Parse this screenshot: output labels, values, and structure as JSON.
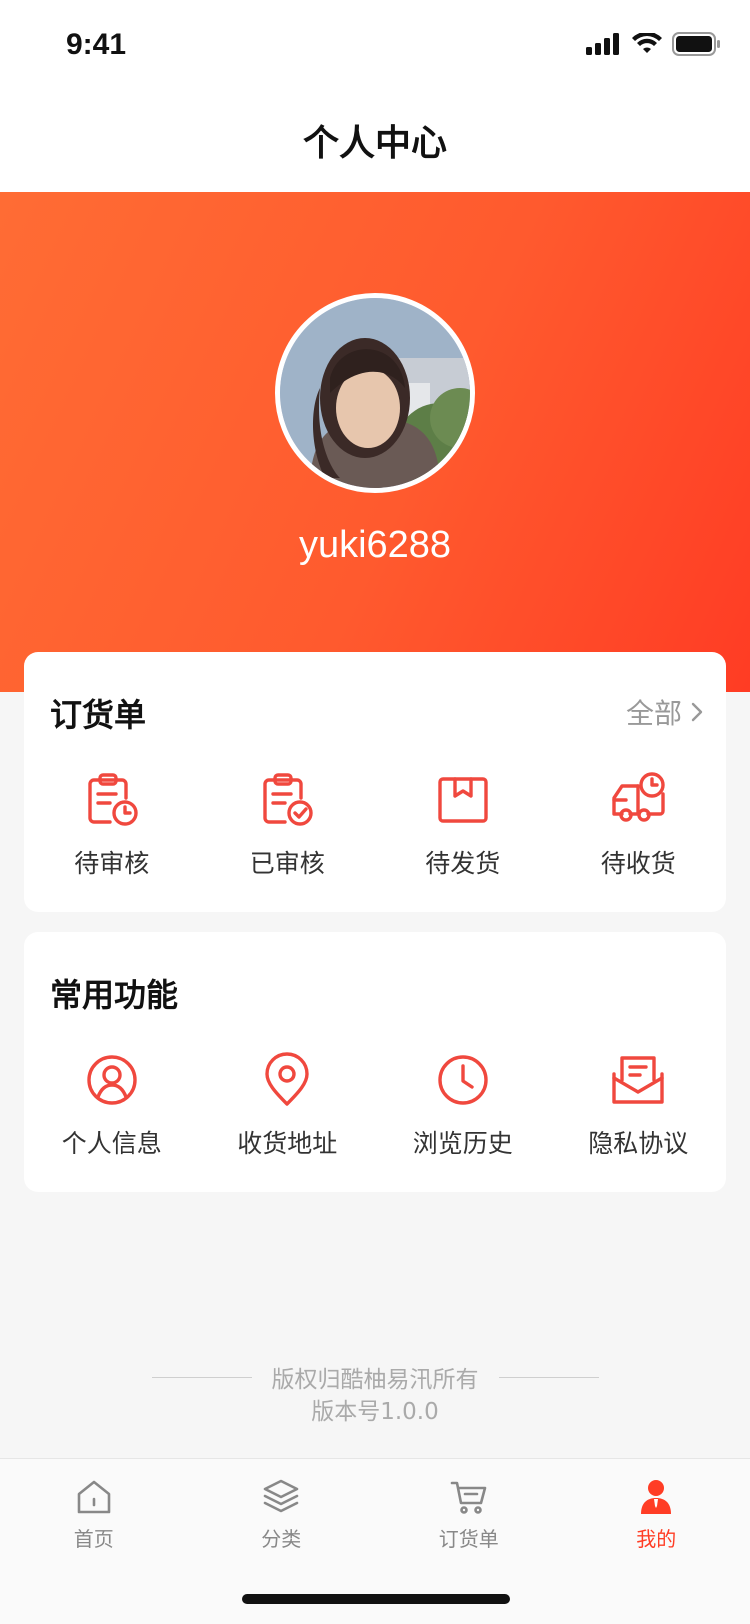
{
  "status": {
    "time": "9:41"
  },
  "nav": {
    "title": "个人中心"
  },
  "profile": {
    "username": "yuki6288"
  },
  "orders": {
    "title": "订货单",
    "more_label": "全部",
    "items": [
      {
        "label": "待审核",
        "icon": "clipboard-clock-icon"
      },
      {
        "label": "已审核",
        "icon": "clipboard-check-icon"
      },
      {
        "label": "待发货",
        "icon": "box-icon"
      },
      {
        "label": "待收货",
        "icon": "delivery-truck-icon"
      }
    ]
  },
  "features": {
    "title": "常用功能",
    "items": [
      {
        "label": "个人信息",
        "icon": "user-circle-icon"
      },
      {
        "label": "收货地址",
        "icon": "location-pin-icon"
      },
      {
        "label": "浏览历史",
        "icon": "clock-icon"
      },
      {
        "label": "隐私协议",
        "icon": "envelope-icon"
      }
    ]
  },
  "footer": {
    "copyright": "版权归酷柚易汛所有",
    "version": "版本号1.0.0"
  },
  "tabbar": {
    "items": [
      {
        "label": "首页",
        "icon": "home-icon"
      },
      {
        "label": "分类",
        "icon": "layers-icon"
      },
      {
        "label": "订货单",
        "icon": "cart-icon"
      },
      {
        "label": "我的",
        "icon": "user-icon",
        "active": true
      }
    ]
  },
  "colors": {
    "accent": "#ff3d25",
    "icon_red": "#f0483e",
    "tab_gray": "#888888"
  }
}
